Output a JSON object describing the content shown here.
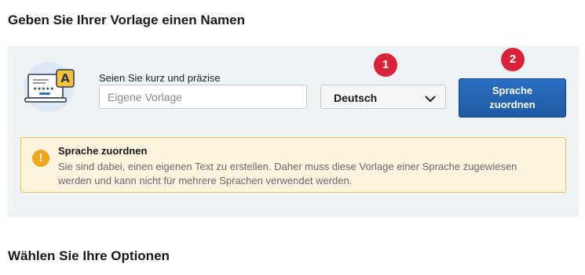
{
  "headings": {
    "name_template": "Geben Sie Ihrer Vorlage einen Namen",
    "choose_options": "Wählen Sie Ihre Optionen"
  },
  "name_input": {
    "label": "Seien Sie kurz und präzise",
    "placeholder": "Eigene Vorlage",
    "value": ""
  },
  "language_select": {
    "selected": "Deutsch",
    "icon": "chevron-down-icon"
  },
  "step_badges": {
    "first": "1",
    "second": "2"
  },
  "assign_button": {
    "line1": "Sprache",
    "line2": "zuordnen"
  },
  "alert": {
    "icon": "exclamation-icon",
    "title": "Sprache zuordnen",
    "text": "Sie sind dabei, einen eigenen Text zu erstellen. Daher muss diese Vorlage einer Sprache zugewiesen werden und kann nicht für mehrere Sprachen verwendet werden."
  },
  "illustration": {
    "letter": "A"
  },
  "colors": {
    "panel_bg": "#eef3f6",
    "badge": "#d9233b",
    "button": "#1f5aa3",
    "alert_bg": "#fdf3df",
    "alert_border": "#e8bf5f",
    "alert_icon": "#f0a81b"
  }
}
